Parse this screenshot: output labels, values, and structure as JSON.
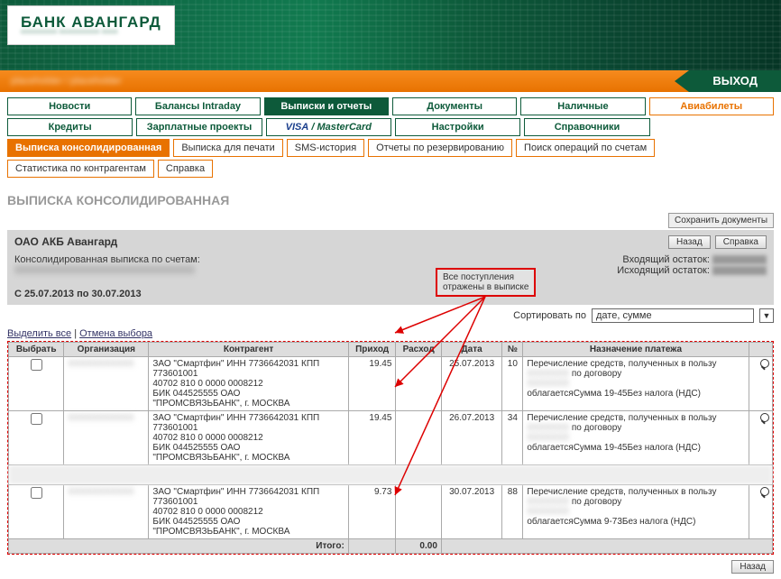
{
  "logo": {
    "text": "БАНК АВАНГАРД"
  },
  "header": {
    "exit": "ВЫХОД",
    "breadcrumb": "placeholder / placeholder"
  },
  "menu": {
    "row1": [
      "Новости",
      "Балансы Intraday",
      "Выписки и отчеты",
      "Документы",
      "Наличные",
      "Авиабилеты"
    ],
    "row2": [
      "Кредиты",
      "Зарплатные проекты",
      "VISA / MasterCard",
      "Настройки",
      "Справочники"
    ]
  },
  "submenu": {
    "row1": [
      "Выписка консолидированная",
      "Выписка для печати",
      "SMS-история",
      "Отчеты по резервированию",
      "Поиск операций по счетам"
    ],
    "row2": [
      "Статистика по контрагентам",
      "Справка"
    ]
  },
  "section_title": "ВЫПИСКА КОНСОЛИДИРОВАННАЯ",
  "save_docs": "Сохранить документы",
  "info": {
    "bank": "ОАО АКБ Авангард",
    "back": "Назад",
    "help": "Справка",
    "consolidated": "Консолидированная выписка по счетам:",
    "period_label": "С 25.07.2013 по 30.07.2013",
    "in_balance": "Входящий остаток:",
    "out_balance": "Исходящий остаток:"
  },
  "annotation": {
    "line1": "Все поступления",
    "line2": "отражены в выписке"
  },
  "sort": {
    "label": "Сортировать по",
    "value": "дате, сумме"
  },
  "links": {
    "select_all": "Выделить все",
    "sep": " | ",
    "cancel_sel": "Отмена выбора"
  },
  "columns": [
    "Выбрать",
    "Организация",
    "Контрагент",
    "Приход",
    "Расход",
    "Дата",
    "№",
    "Назначение платежа",
    ""
  ],
  "rows": [
    {
      "prihod": "19.45",
      "date": "25.07.2013",
      "num": "10",
      "counterparty": [
        "ЗАО \"Смартфин\" ИНН 7736642031 КПП",
        "773601001",
        "40702 810 0 0000 0008212",
        "БИК 044525555 ОАО",
        "\"ПРОМСВЯЗЬБАНК\", г. МОСКВА"
      ],
      "purpose": [
        "Перечисление средств, полученных в пользу",
        "по договору",
        "облагаетсяСумма 19-45Без налога (НДС)"
      ]
    },
    {
      "prihod": "19.45",
      "date": "26.07.2013",
      "num": "34",
      "counterparty": [
        "ЗАО \"Смартфин\" ИНН 7736642031 КПП",
        "773601001",
        "40702 810 0 0000 0008212",
        "БИК 044525555 ОАО",
        "\"ПРОМСВЯЗЬБАНК\", г. МОСКВА"
      ],
      "purpose": [
        "Перечисление средств, полученных в пользу",
        "по договору",
        "облагаетсяСумма 19-45Без налога (НДС)"
      ]
    },
    {
      "prihod": "9.73",
      "date": "30.07.2013",
      "num": "88",
      "counterparty": [
        "ЗАО \"Смартфин\" ИНН 7736642031 КПП",
        "773601001",
        "40702 810 0 0000 0008212",
        "БИК 044525555 ОАО",
        "\"ПРОМСВЯЗЬБАНК\", г. МОСКВА"
      ],
      "purpose": [
        "Перечисление средств, полученных в пользу",
        "по договору",
        "облагаетсяСумма 9-73Без налога (НДС)"
      ]
    }
  ],
  "totals": {
    "label": "Итого:",
    "rashod": "0.00"
  },
  "footer_back": "Назад"
}
